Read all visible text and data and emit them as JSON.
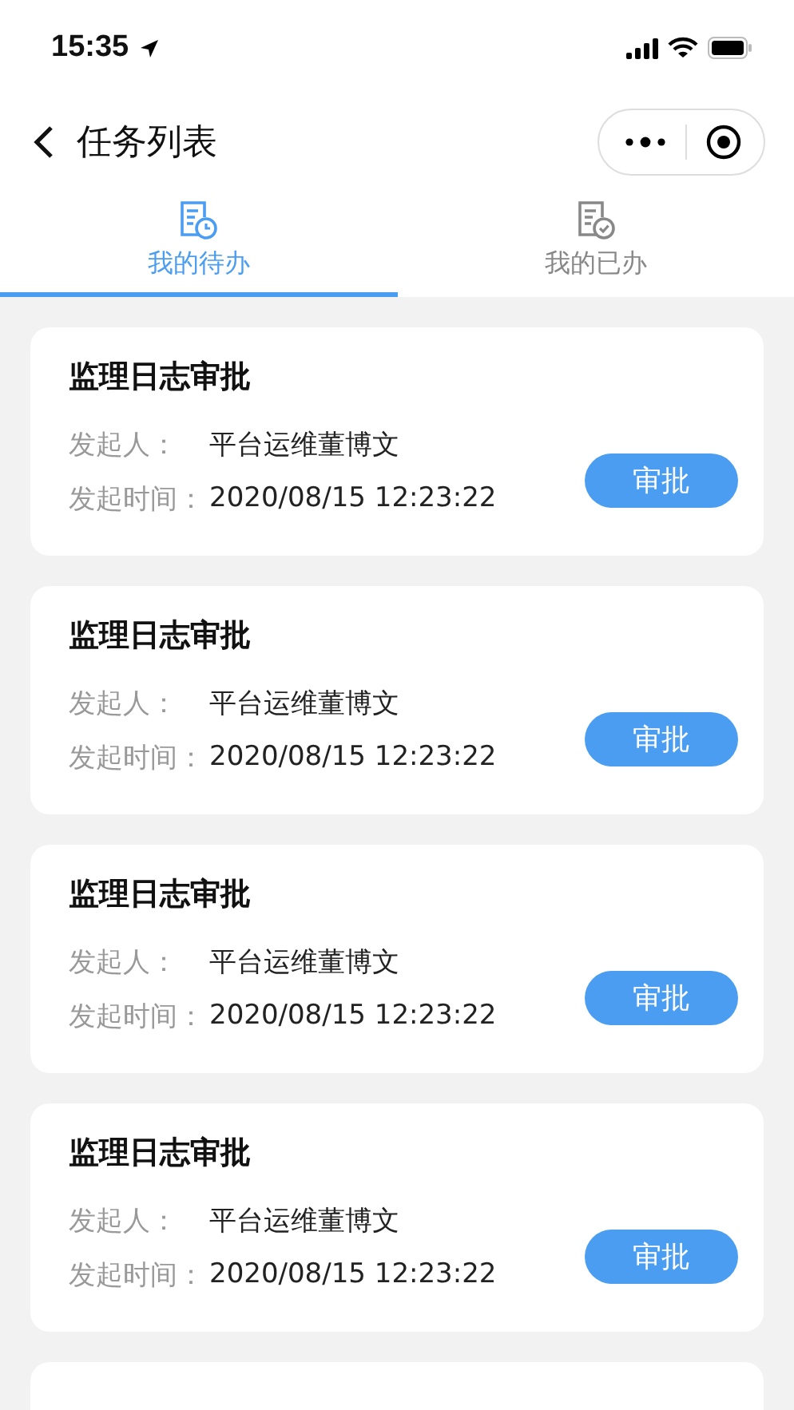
{
  "status_bar": {
    "time": "15:35"
  },
  "nav": {
    "title": "任务列表"
  },
  "tabs": [
    {
      "label": "我的待办",
      "selected": true,
      "kind": "pending"
    },
    {
      "label": "我的已办",
      "selected": false,
      "kind": "done"
    }
  ],
  "tasks": [
    {
      "title": "监理日志审批",
      "initiator_label": "发起人：",
      "initiator": "平台运维董博文",
      "time_label": "发起时间：",
      "time": "2020/08/15 12:23:22",
      "action": "审批"
    },
    {
      "title": "监理日志审批",
      "initiator_label": "发起人：",
      "initiator": "平台运维董博文",
      "time_label": "发起时间：",
      "time": "2020/08/15 12:23:22",
      "action": "审批"
    },
    {
      "title": "监理日志审批",
      "initiator_label": "发起人：",
      "initiator": "平台运维董博文",
      "time_label": "发起时间：",
      "time": "2020/08/15 12:23:22",
      "action": "审批"
    },
    {
      "title": "监理日志审批",
      "initiator_label": "发起人：",
      "initiator": "平台运维董博文",
      "time_label": "发起时间：",
      "time": "2020/08/15 12:23:22",
      "action": "审批"
    }
  ]
}
